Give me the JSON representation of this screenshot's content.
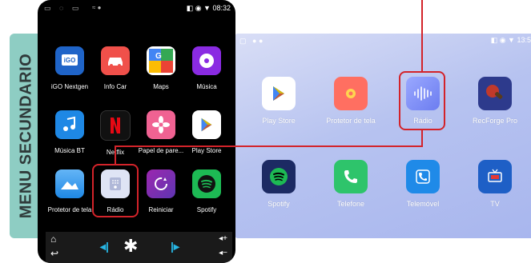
{
  "side_label": "MENU SECUNDARIO",
  "phone": {
    "status_time": "08:32",
    "apps": [
      {
        "label": "iGO Nextgen",
        "icon": "igo-icon",
        "bg": "#1f64c8"
      },
      {
        "label": "Info Car",
        "icon": "car-icon",
        "bg": "#f0504a"
      },
      {
        "label": "Maps",
        "icon": "maps-icon",
        "bg": "#ffffff"
      },
      {
        "label": "Música",
        "icon": "music-disc-icon",
        "bg": "#8a2be2"
      },
      {
        "label": "Música BT",
        "icon": "music-note-icon",
        "bg": "#1e88e5"
      },
      {
        "label": "Netflix",
        "icon": "netflix-icon",
        "bg": "#111111"
      },
      {
        "label": "Papel de pare...",
        "icon": "flower-icon",
        "bg": "#f06292"
      },
      {
        "label": "Play Store",
        "icon": "play-store-icon",
        "bg": "#ffffff"
      },
      {
        "label": "Protetor de tela",
        "icon": "landscape-icon",
        "bg": "#2196f3"
      },
      {
        "label": "Rádio",
        "icon": "radio-icon",
        "bg": "#dfe4f5"
      },
      {
        "label": "Reiniciar",
        "icon": "restart-icon",
        "bg": "#7b3fb0"
      },
      {
        "label": "Spotify",
        "icon": "spotify-icon",
        "bg": "#1db954"
      }
    ]
  },
  "tablet": {
    "status_time": "13:5",
    "apps": [
      {
        "label": "Play Store",
        "icon": "play-store-icon",
        "bg": "#ffffff"
      },
      {
        "label": "Protetor de tela",
        "icon": "lightbulb-icon",
        "bg": "#ff6f61"
      },
      {
        "label": "Rádio",
        "icon": "radio-wave-icon",
        "bg": "#7b8cf5"
      },
      {
        "label": "RecForge Pro",
        "icon": "microphone-icon",
        "bg": "#2d3a8c"
      },
      {
        "label": "Spotify",
        "icon": "spotify-icon",
        "bg": "#1c2a63"
      },
      {
        "label": "Telefone",
        "icon": "phone-icon",
        "bg": "#2ec46b"
      },
      {
        "label": "Telemóvel",
        "icon": "phone-alt-icon",
        "bg": "#1f8ae8"
      },
      {
        "label": "TV",
        "icon": "tv-icon",
        "bg": "#1e5fc6"
      }
    ]
  },
  "colors": {
    "highlight": "#d3232a",
    "side_label_bg": "#8ecdc3"
  }
}
